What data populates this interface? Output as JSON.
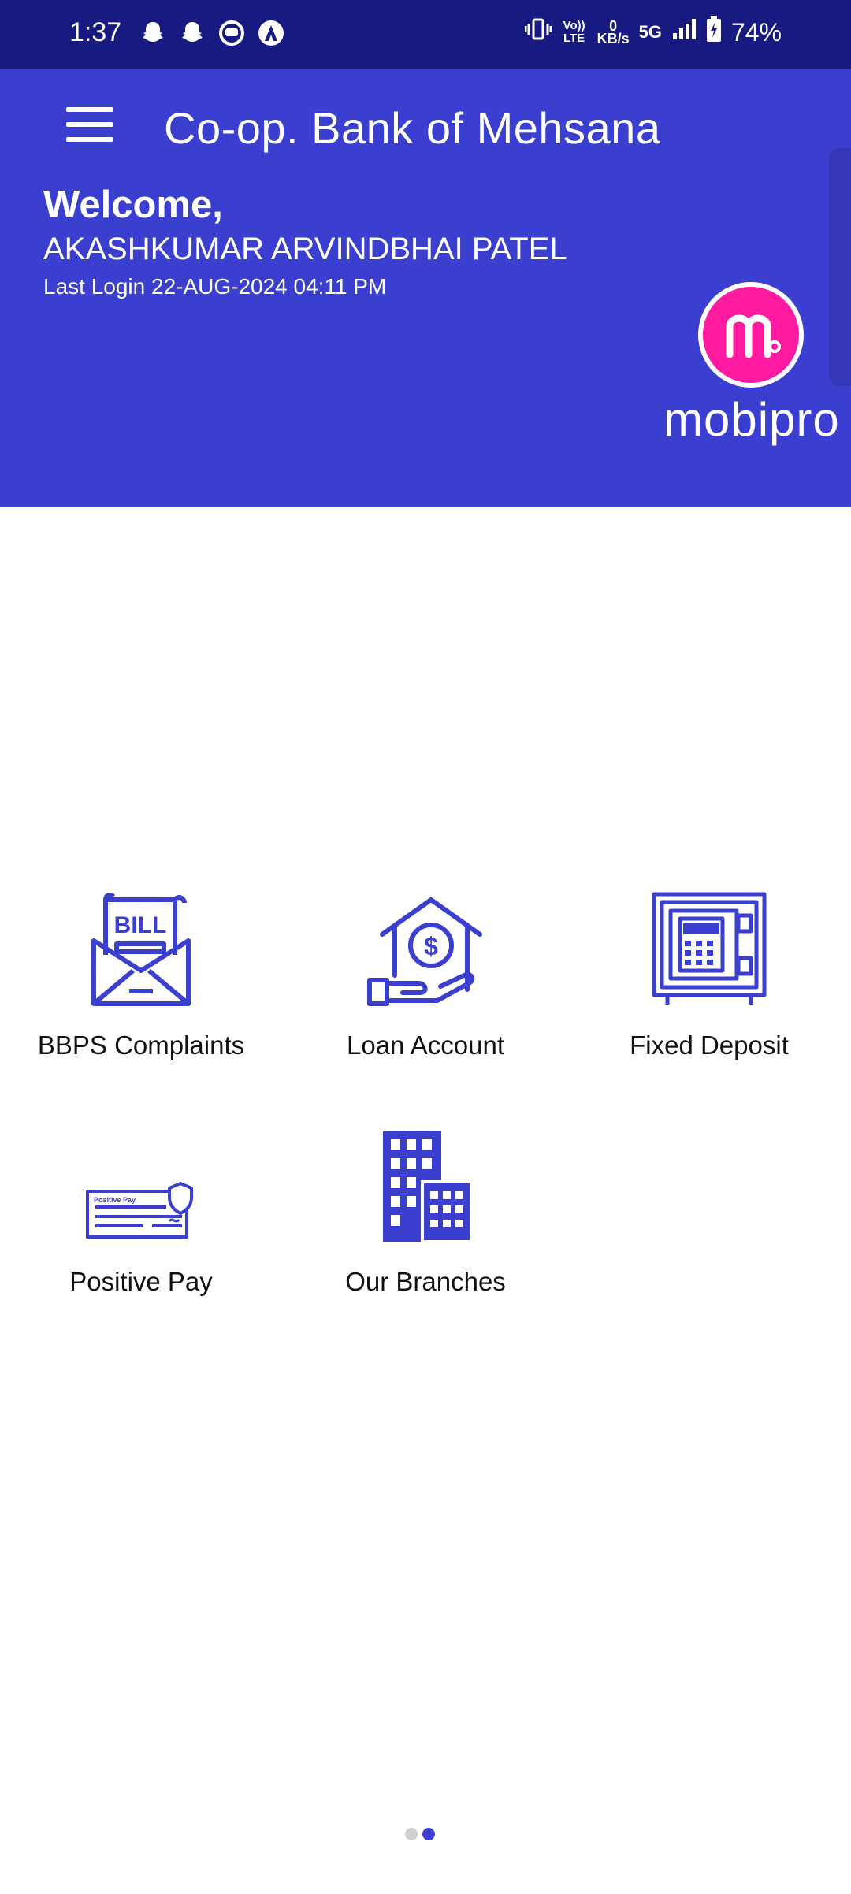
{
  "status_bar": {
    "time": "1:37",
    "volte": "Vo)) LTE",
    "data_rate_value": "0",
    "data_rate_unit": "KB/s",
    "network": "5G",
    "battery": "74%"
  },
  "header": {
    "title": "Co-op. Bank of Mehsana",
    "welcome": "Welcome,",
    "user_name": "AKASHKUMAR ARVINDBHAI PATEL",
    "last_login": "Last Login 22-AUG-2024 04:11 PM"
  },
  "brand": {
    "logo_text": "mobipro",
    "logo_color": "#ff1aa0"
  },
  "colors": {
    "status_bar": "#171a80",
    "header": "#3a3fd0",
    "icon": "#3a3fd0"
  },
  "menu": {
    "items": [
      {
        "label": "BBPS Complaints",
        "icon": "bill-envelope-icon",
        "icon_text": "BILL"
      },
      {
        "label": "Loan Account",
        "icon": "house-dollar-hand-icon"
      },
      {
        "label": "Fixed Deposit",
        "icon": "safe-locker-icon"
      },
      {
        "label": "Positive Pay",
        "icon": "cheque-shield-icon",
        "icon_text": "Positive Pay"
      },
      {
        "label": "Our Branches",
        "icon": "buildings-icon"
      }
    ]
  },
  "pager": {
    "total": 2,
    "active": 2
  }
}
